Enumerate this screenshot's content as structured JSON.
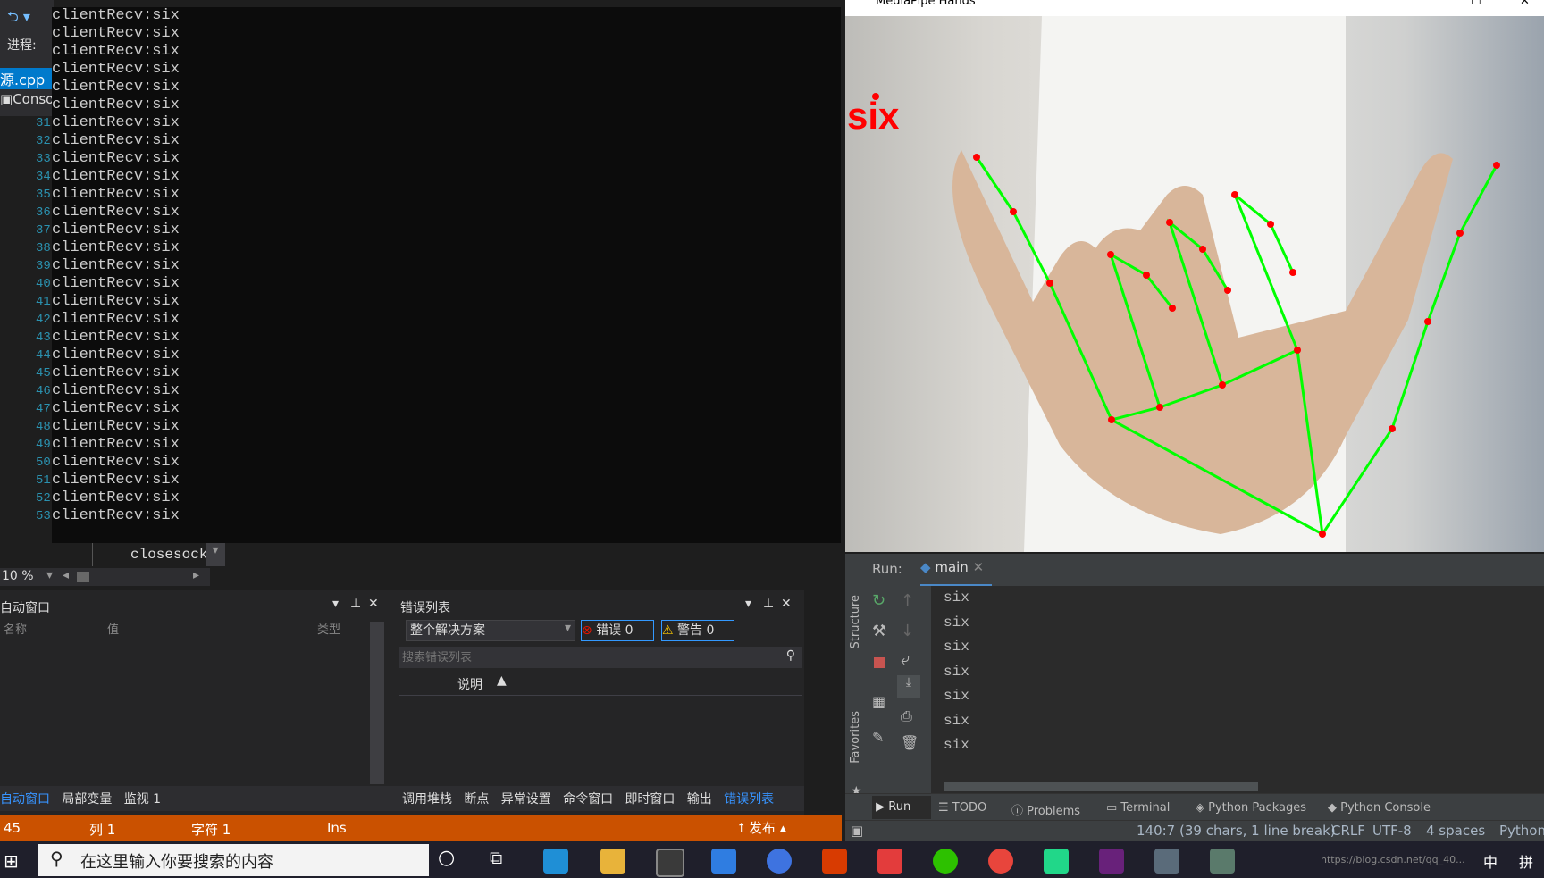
{
  "vs": {
    "nav_label": "进程:",
    "file_tab": "源.cpp",
    "console_tab": "Console",
    "line_numbers": [
      "31",
      "32",
      "33",
      "34",
      "35",
      "36",
      "37",
      "38",
      "39",
      "40",
      "41",
      "42",
      "43",
      "44",
      "45",
      "46",
      "47",
      "48",
      "49",
      "50",
      "51",
      "52",
      "53"
    ],
    "code_fragment": "closesocke",
    "zoom": "10 %",
    "auto_window": {
      "title": "自动窗口",
      "col_name": "名称",
      "col_value": "值",
      "col_type": "类型"
    },
    "error_list": {
      "title": "错误列表",
      "scope": "整个解决方案",
      "errors": "错误 0",
      "warnings": "警告 0",
      "search_placeholder": "搜索错误列表",
      "col_desc": "说明"
    },
    "left_tabs": [
      "自动窗口",
      "局部变量",
      "监视 1"
    ],
    "right_tabs": [
      "调用堆栈",
      "断点",
      "异常设置",
      "命令窗口",
      "即时窗口",
      "输出",
      "错误列表"
    ],
    "status": {
      "line": "45",
      "col": "列 1",
      "char": "字符 1",
      "mode": "Ins",
      "publish": "发布"
    }
  },
  "console": {
    "lines": [
      "clientRecv:six",
      "clientRecv:six",
      "clientRecv:six",
      "clientRecv:six",
      "clientRecv:six",
      "clientRecv:six",
      "clientRecv:six",
      "clientRecv:six",
      "clientRecv:six",
      "clientRecv:six",
      "clientRecv:six",
      "clientRecv:six",
      "clientRecv:six",
      "clientRecv:six",
      "clientRecv:six",
      "clientRecv:six",
      "clientRecv:six",
      "clientRecv:six",
      "clientRecv:six",
      "clientRecv:six",
      "clientRecv:six",
      "clientRecv:six",
      "clientRecv:six",
      "clientRecv:six",
      "clientRecv:six",
      "clientRecv:six",
      "clientRecv:six",
      "clientRecv:six",
      "clientRecv:six"
    ]
  },
  "mediapipe": {
    "title": "MediaPipe Hands",
    "overlay_label": "six",
    "colors": {
      "skeleton": "#00ff00",
      "joint": "#ff0000",
      "label": "#ff0000"
    }
  },
  "pycharm": {
    "run_label": "Run:",
    "tab": "main",
    "output": [
      "six",
      "six",
      "six",
      "six",
      "six",
      "six",
      "six"
    ],
    "side_labels": [
      "Structure",
      "Favorites"
    ],
    "bottom_tabs": [
      "Run",
      "TODO",
      "Problems",
      "Terminal",
      "Python Packages",
      "Python Console"
    ],
    "status": {
      "position": "140:7 (39 chars, 1 line break)",
      "line_sep": "CRLF",
      "encoding": "UTF-8",
      "indent": "4 spaces",
      "interpreter": "Python"
    }
  },
  "taskbar": {
    "search_placeholder": "在这里输入你要搜索的内容",
    "ime": "中",
    "ime2": "拼",
    "watermark": "https://blog.csdn.net/qq_40..."
  }
}
